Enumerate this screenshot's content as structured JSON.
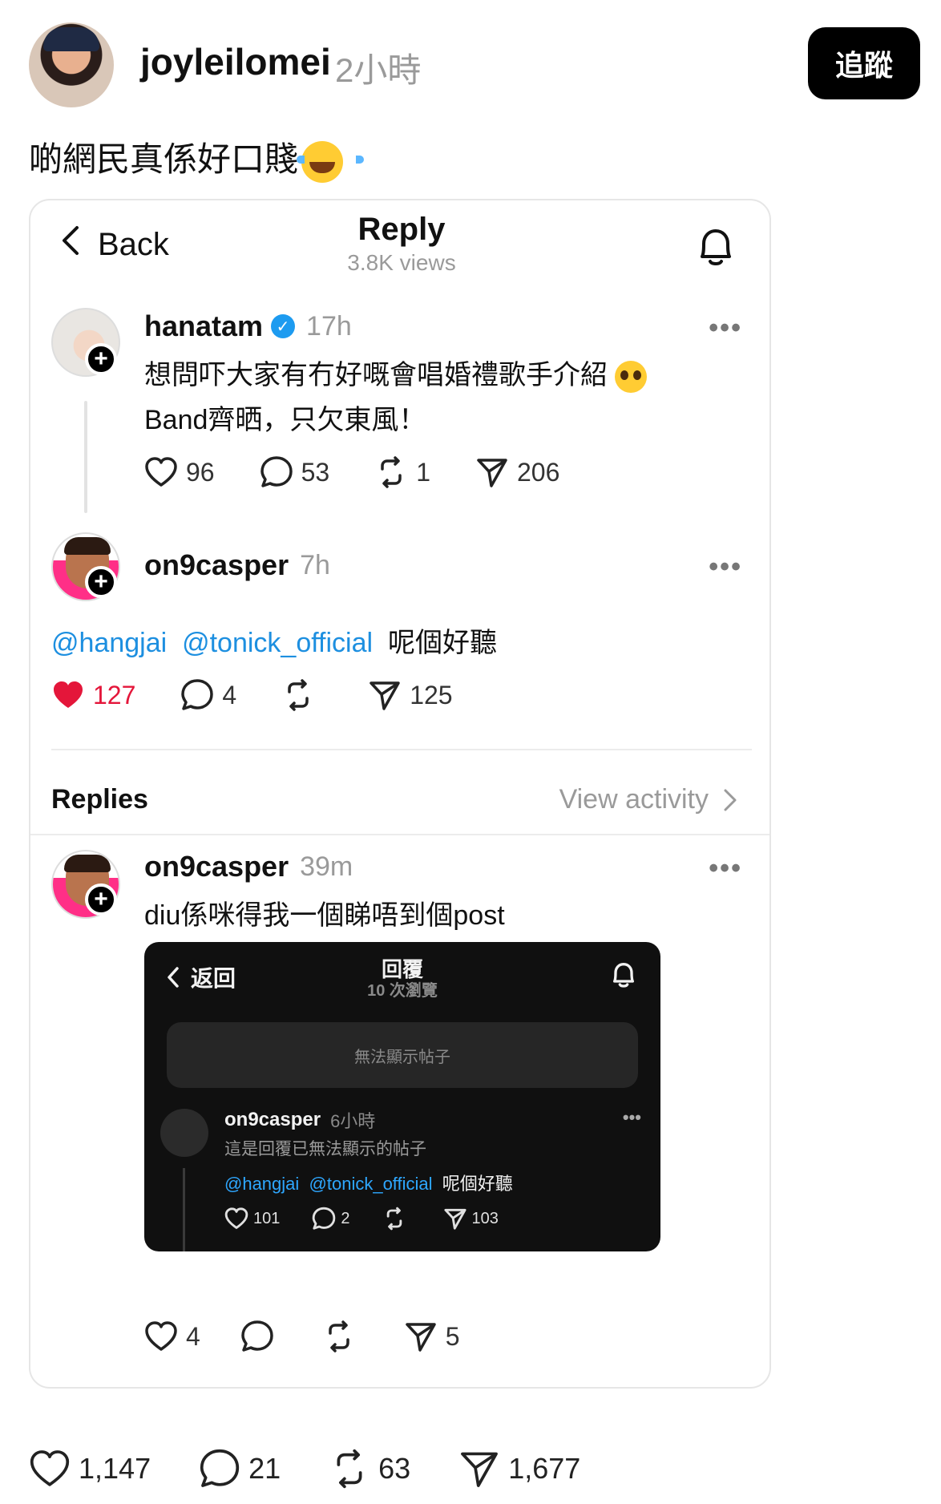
{
  "post": {
    "author": "joyleilomei",
    "time": "2小時",
    "follow_label": "追蹤",
    "text": "啲網民真係好口賤",
    "emoji": "laughing-tears-emoji"
  },
  "embed": {
    "back_label": "Back",
    "title": "Reply",
    "views": "3.8K views",
    "thread": [
      {
        "user": "hanatam",
        "verified": true,
        "time": "17h",
        "line1": "想問吓大家有冇好嘅會唱婚禮歌手介紹",
        "line2": "Band齊晒，只欠東風！",
        "likes": "96",
        "comments": "53",
        "reposts": "1",
        "shares": "206"
      },
      {
        "user": "on9casper",
        "time": "7h",
        "mention1": "@hangjai",
        "mention2": "@tonick_official",
        "text": "呢個好聽",
        "likes": "127",
        "comments": "4",
        "reposts": "",
        "shares": "125"
      }
    ],
    "replies_label": "Replies",
    "view_activity_label": "View activity",
    "reply": {
      "user": "on9casper",
      "time": "39m",
      "text": "diu係咪得我一個睇唔到個post",
      "likes": "4",
      "comments": "",
      "reposts": "",
      "shares": "5"
    },
    "nested": {
      "back_label": "返回",
      "title": "回覆",
      "views": "10 次瀏覽",
      "hidden_notice": "無法顯示帖子",
      "user": "on9casper",
      "time": "6小時",
      "subtitle": "這是回覆已無法顯示的帖子",
      "mention1": "@hangjai",
      "mention2": "@tonick_official",
      "text": "呢個好聽",
      "likes": "101",
      "comments": "2",
      "shares": "103"
    }
  },
  "footer": {
    "likes": "1,147",
    "comments": "21",
    "reposts": "63",
    "shares": "1,677"
  },
  "colors": {
    "accent_link": "#1d8fe0",
    "like_red": "#e4163a",
    "verified_blue": "#1d9bf0"
  }
}
